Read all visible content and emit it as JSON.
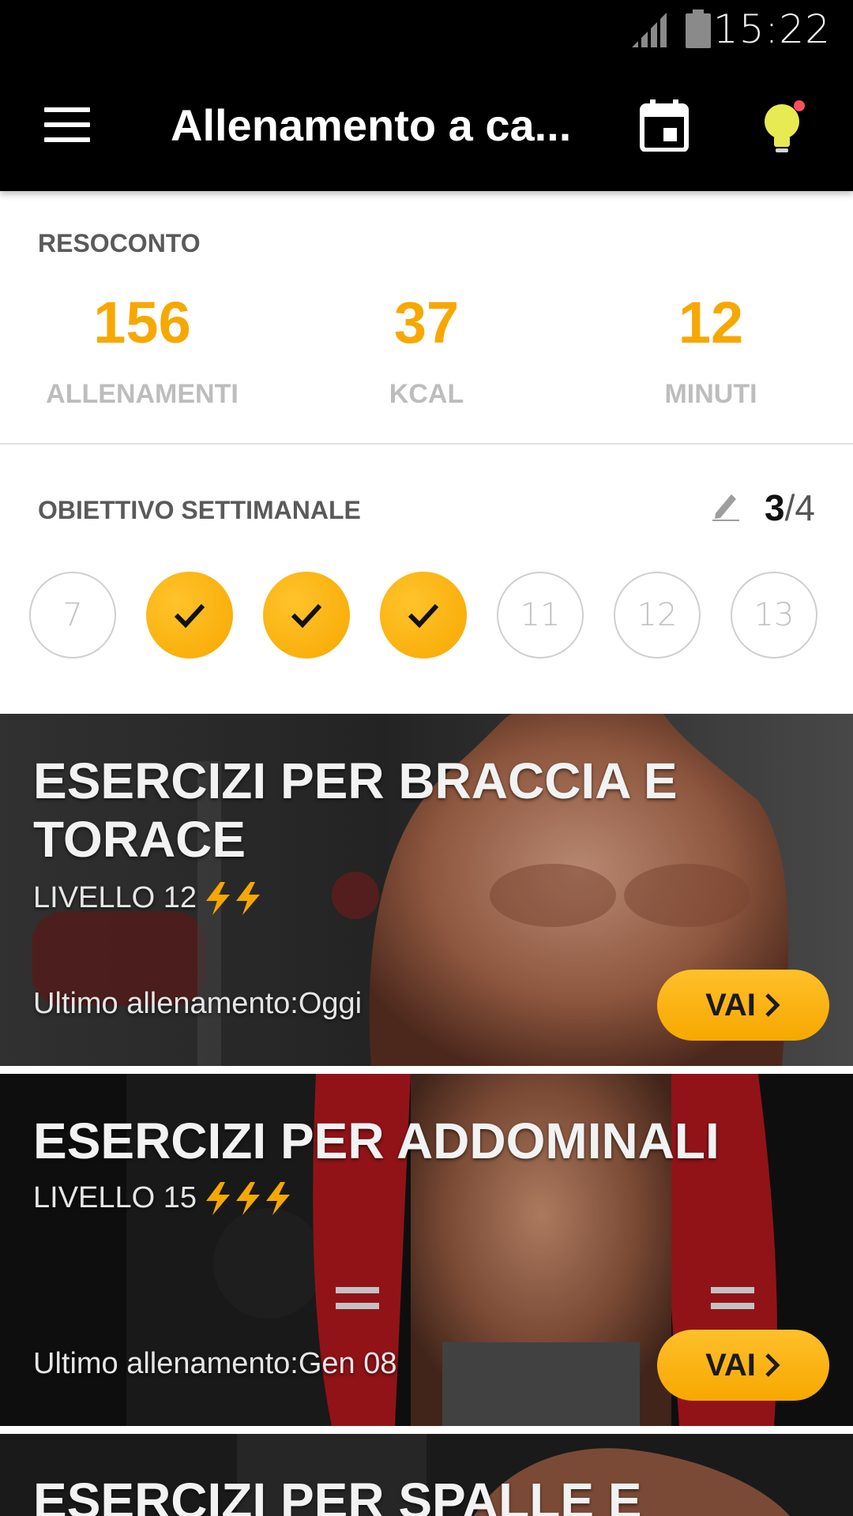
{
  "status_bar": {
    "time": "15:22"
  },
  "app_bar": {
    "title": "Allenamento a ca..."
  },
  "summary": {
    "label": "RESOCONTO",
    "stats": [
      {
        "value": "156",
        "label": "ALLENAMENTI"
      },
      {
        "value": "37",
        "label": "KCAL"
      },
      {
        "value": "12",
        "label": "MINUTI"
      }
    ]
  },
  "weekly_goal": {
    "label": "OBIETTIVO SETTIMANALE",
    "done": "3",
    "total": "/4",
    "days": [
      {
        "label": "7",
        "done": false
      },
      {
        "label": "",
        "done": true
      },
      {
        "label": "",
        "done": true
      },
      {
        "label": "",
        "done": true
      },
      {
        "label": "11",
        "done": false
      },
      {
        "label": "12",
        "done": false
      },
      {
        "label": "13",
        "done": false
      }
    ]
  },
  "cards": [
    {
      "title": "ESERCIZI PER BRACCIA E TORACE",
      "level": "LIVELLO 12",
      "bolts": 2,
      "last": "Ultimo allenamento:Oggi",
      "button": "VAI"
    },
    {
      "title": "ESERCIZI PER ADDOMINALI",
      "level": "LIVELLO 15",
      "bolts": 3,
      "last": "Ultimo allenamento:Gen 08",
      "button": "VAI"
    },
    {
      "title": "ESERCIZI PER SPALLE E"
    }
  ],
  "colors": {
    "accent": "#f7a800",
    "app_bar": "#000000",
    "muted_label": "#bdbdbd"
  },
  "icons": {
    "menu": "hamburger-icon",
    "calendar": "calendar-icon",
    "tip": "lightbulb-icon",
    "edit": "pencil-icon",
    "level": "lightning-bolt-icon",
    "check": "check-icon",
    "chevron": "chevron-right-icon"
  }
}
